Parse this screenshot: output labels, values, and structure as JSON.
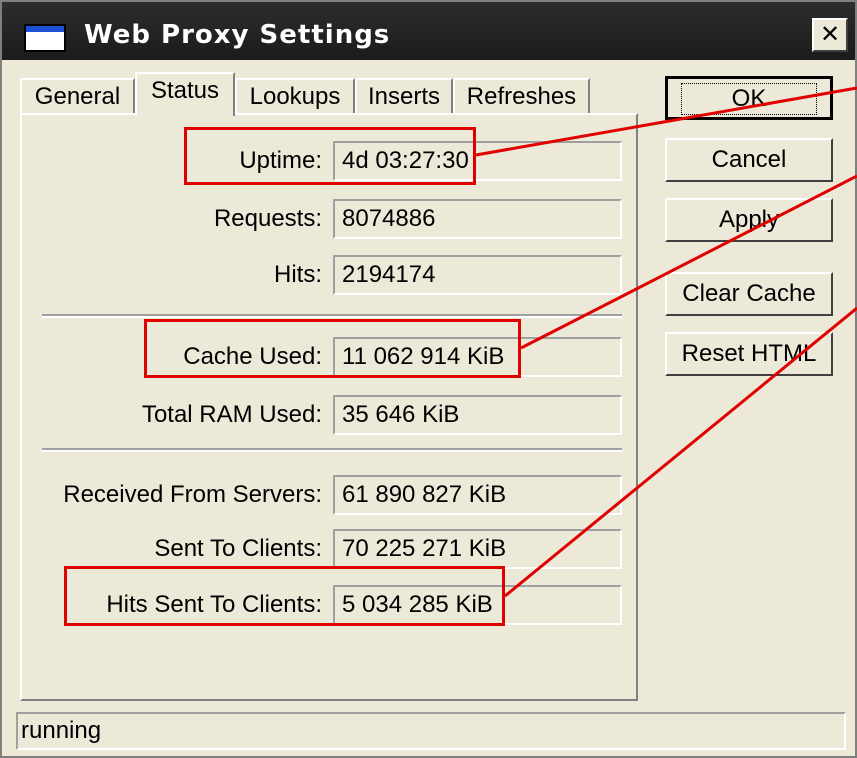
{
  "window": {
    "title": "Web Proxy Settings",
    "close_label": "✕"
  },
  "tabs": [
    {
      "label": "General",
      "active": false
    },
    {
      "label": "Status",
      "active": true
    },
    {
      "label": "Lookups",
      "active": false
    },
    {
      "label": "Inserts",
      "active": false
    },
    {
      "label": "Refreshes",
      "active": false
    }
  ],
  "status": {
    "uptime": {
      "label": "Uptime:",
      "value": "4d 03:27:30"
    },
    "requests": {
      "label": "Requests:",
      "value": "8074886"
    },
    "hits": {
      "label": "Hits:",
      "value": "2194174"
    },
    "cache_used": {
      "label": "Cache Used:",
      "value": "11 062 914 KiB"
    },
    "total_ram_used": {
      "label": "Total RAM Used:",
      "value": "35 646 KiB"
    },
    "received_from_servers": {
      "label": "Received From Servers:",
      "value": "61 890 827 KiB"
    },
    "sent_to_clients": {
      "label": "Sent To Clients:",
      "value": "70 225 271 KiB"
    },
    "hits_sent_to_clients": {
      "label": "Hits Sent To Clients:",
      "value": "5 034 285 KiB"
    }
  },
  "buttons": {
    "ok": "OK",
    "cancel": "Cancel",
    "apply": "Apply",
    "clear_cache": "Clear Cache",
    "reset_html": "Reset HTML"
  },
  "statusbar": {
    "text": "running"
  },
  "colors": {
    "highlight": "#e00000",
    "titlebar": "#1b1b1b",
    "window_bg": "#ece9d8"
  }
}
